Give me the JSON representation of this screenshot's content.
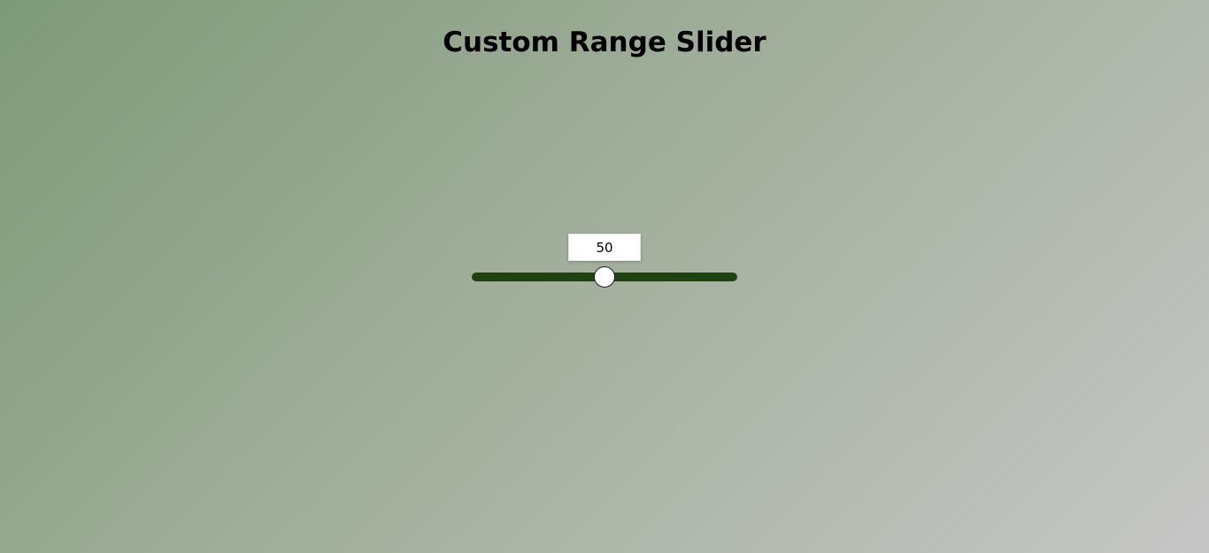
{
  "page": {
    "title": "Custom Range Slider"
  },
  "slider": {
    "value": 50,
    "value_label": "50",
    "min": 0,
    "max": 100,
    "track_color": "#1f4211",
    "thumb_color": "#ffffff"
  },
  "theme": {
    "background_start": "#7e9a78",
    "background_end": "#c6c6c6"
  }
}
